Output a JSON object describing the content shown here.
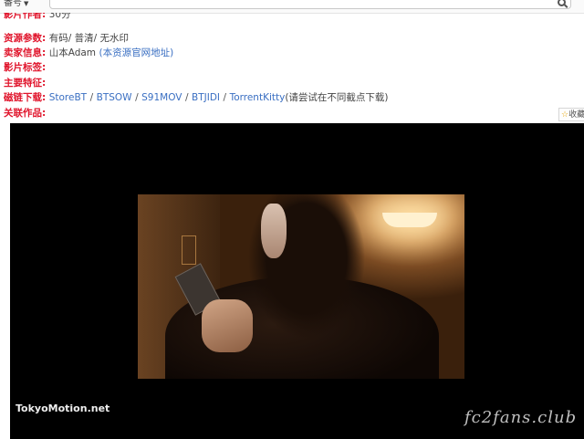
{
  "search": {
    "field_label": "番号",
    "value": "",
    "placeholder": ""
  },
  "details": {
    "partial_row": {
      "label": "影片作者:",
      "value": "30分"
    },
    "resource_params": {
      "label": "资源参数:",
      "value": "有码/ 普清/ 无水印"
    },
    "seller_info": {
      "label": "卖家信息:",
      "value": "山本Adam",
      "link": "(本资源官网地址)"
    },
    "tags": {
      "label": "影片标签:",
      "value": ""
    },
    "features": {
      "label": "主要特征:",
      "value": ""
    },
    "magnet": {
      "label": "磁链下载:",
      "links": [
        "StoreBT",
        "BTSOW",
        "S91MOV",
        "BTJIDI",
        "TorrentKitty"
      ],
      "separator": "/",
      "note": "(请尝试在不同截点下载)"
    },
    "related": {
      "label": "关联作品:",
      "value": ""
    }
  },
  "favorite": {
    "label": "收藏",
    "icon": "star-icon"
  },
  "video": {
    "watermark_left": "TokyoMotion.net",
    "watermark_right": "fc2fans.club"
  },
  "colors": {
    "label_red": "#e0142b",
    "link_blue": "#3a6fc2",
    "player_bg": "#000000"
  }
}
